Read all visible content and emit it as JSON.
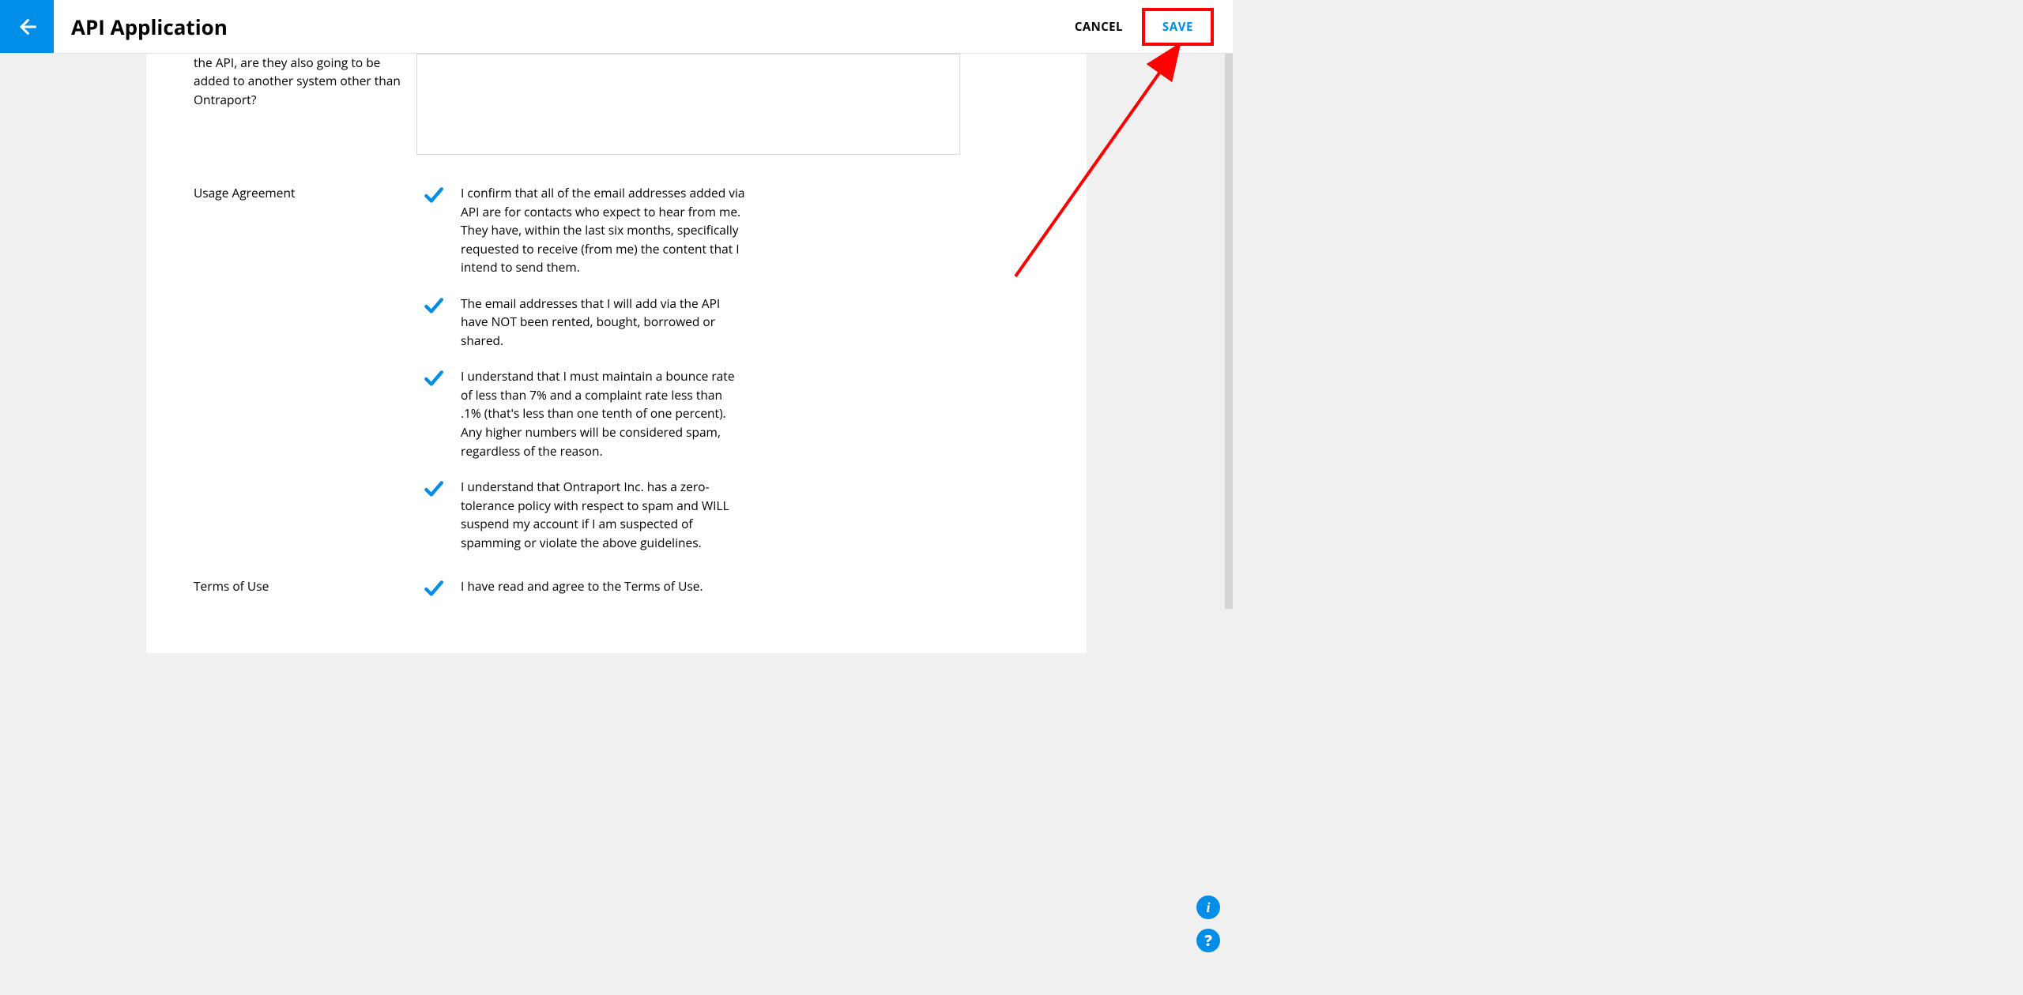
{
  "header": {
    "page_title": "API Application",
    "cancel_label": "CANCEL",
    "save_label": "SAVE"
  },
  "form": {
    "question_other_system": {
      "label": "the API, are they also going to be added to another system other than Ontraport?",
      "value": ""
    },
    "usage_agreement": {
      "label": "Usage Agreement",
      "items": [
        "I confirm that all of the email addresses added via API are for contacts who expect to hear from me. They have, within the last six months, specifically requested to receive (from me) the content that I intend to send them.",
        "The email addresses that I will add via the API have NOT been rented, bought, borrowed or shared.",
        "I understand that I must maintain a bounce rate of less than 7% and a complaint rate less than .1% (that's less than one tenth of one percent). Any higher numbers will be considered spam, regardless of the reason.",
        "I understand that Ontraport Inc. has a zero-tolerance policy with respect to spam and WILL suspend my account if I am suspected of spamming or violate the above guidelines."
      ]
    },
    "terms_of_use": {
      "label": "Terms of Use",
      "text": "I have read and agree to the Terms of Use."
    }
  },
  "fab": {
    "info_glyph": "i",
    "help_glyph": "?"
  },
  "annotation": {
    "note": "Red highlight box around SAVE and arrow pointing to it (editorial annotation, not part of UI)."
  }
}
